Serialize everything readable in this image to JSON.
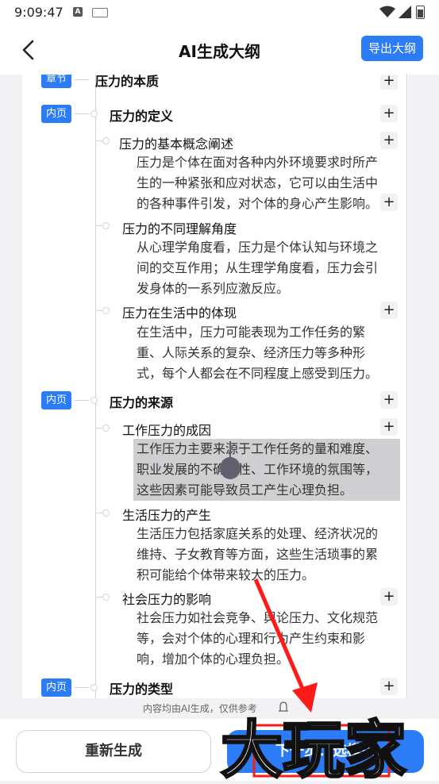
{
  "status_bar": {
    "time": "9:09:47",
    "a_icon": "A"
  },
  "header": {
    "title": "AI生成大纲",
    "export_label": "导出大纲"
  },
  "outline": {
    "chapter": {
      "tag": "章节",
      "title": "压力的本质"
    },
    "sections": [
      {
        "tag": "内页",
        "title": "压力的定义",
        "items": [
          {
            "title": "压力的基本概念阐述",
            "body": [
              "压力是个体在面对各种内外环境要求时所产",
              "生的一种紧张和应对状态，它可以由生活中",
              "的各种事件引发，对个体的身心产生影响。"
            ]
          },
          {
            "title": "压力的不同理解角度",
            "body": [
              "从心理学角度看，压力是个体认知与环境之",
              "间的交互作用；从生理学角度看，压力会引",
              "发身体的一系列应激反应。"
            ]
          },
          {
            "title": "压力在生活中的体现",
            "body": [
              "在生活中，压力可能表现为工作任务的繁",
              "重、人际关系的复杂、经济压力等多种形",
              "式，每个人都会在不同程度上感受到压力。"
            ]
          }
        ]
      },
      {
        "tag": "内页",
        "title": "压力的来源",
        "items": [
          {
            "title": "工作压力的成因",
            "body": [
              "工作压力主要来源于工作任务的量和难度、",
              "职业发展的不确定性、工作环境的氛围等，",
              "这些因素可能导致员工产生心理负担。"
            ]
          },
          {
            "title": "生活压力的产生",
            "body": [
              "生活压力包括家庭关系的处理、经济状况的",
              "维持、子女教育等方面，这些生活琐事的累",
              "积可能给个体带来较大的压力。"
            ]
          },
          {
            "title": "社会压力的影响",
            "body": [
              "社会压力如社会竞争、舆论压力、文化规范",
              "等，会对个体的心理和行为产生约束和影",
              "响，增加个体的心理负担。"
            ]
          }
        ]
      },
      {
        "tag": "内页",
        "title": "压力的类型",
        "items": []
      }
    ]
  },
  "plus_label": "+",
  "disclaimer": "内容均由AI生成，仅供参考",
  "buttons": {
    "regenerate": "重新生成",
    "next": "下一步：选模版"
  },
  "watermark": "大玩家",
  "colors": {
    "accent": "#2b7cf6",
    "annotation": "#ff1a1a"
  }
}
